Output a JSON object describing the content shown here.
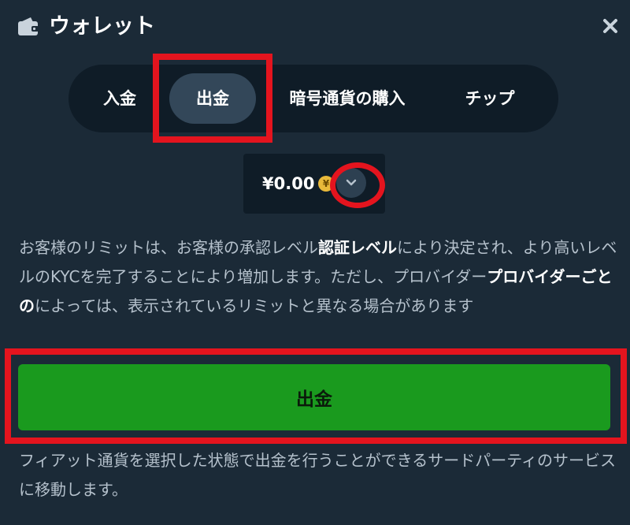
{
  "header": {
    "title": "ウォレット",
    "wallet_icon": "wallet-icon",
    "close_icon": "close-icon"
  },
  "tabs": [
    {
      "label": "入金",
      "active": false
    },
    {
      "label": "出金",
      "active": true
    },
    {
      "label": "暗号通貨の購入",
      "active": false
    },
    {
      "label": "チップ",
      "active": false
    }
  ],
  "currency": {
    "amount": "¥0.00",
    "coin_symbol": "¥",
    "dropdown_icon": "chevron-down-icon"
  },
  "info": {
    "part1": "お客様のリミットは、お客様の承認レベル",
    "bold1": "認証レベル",
    "part2": "により決定され、より高いレベルのKYCを完了することにより増加します。ただし、プロバイダー",
    "bold2": "プロバイダーごとの",
    "part3": "によっては、表示されているリミットと異なる場合があります"
  },
  "withdraw_button": {
    "label": "出金"
  },
  "note": "フィアット通貨を選択した状態で出金を行うことができるサードパーティのサービスに移動します。",
  "colors": {
    "background": "#1b2a37",
    "panel": "#0f1c27",
    "active_tab": "#334759",
    "button": "#1a9a1e",
    "highlight": "#e4141e",
    "coin": "#e9b93a"
  }
}
